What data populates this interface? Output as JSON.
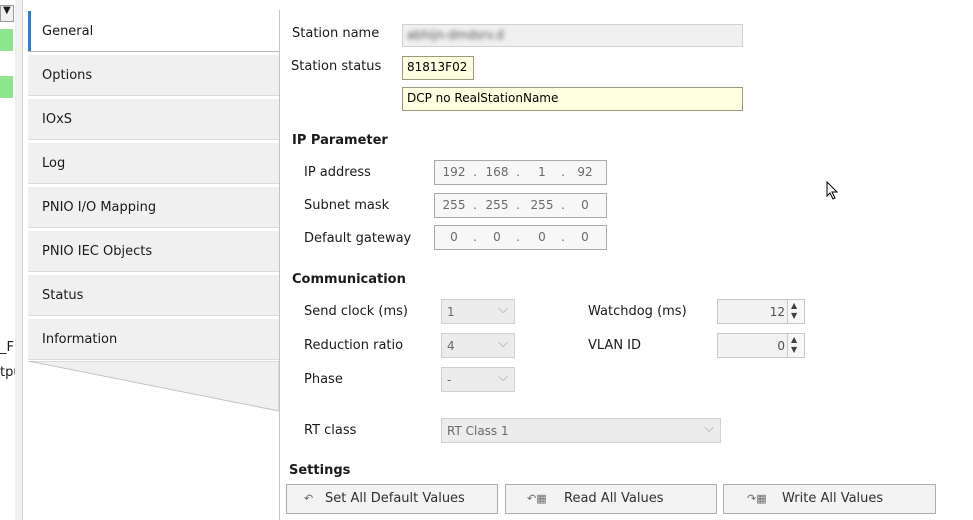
{
  "left_strip": {
    "fragments": [
      "_F",
      "tpu"
    ]
  },
  "tabs": [
    {
      "label": "General",
      "active": true
    },
    {
      "label": "Options"
    },
    {
      "label": "IOxS"
    },
    {
      "label": "Log"
    },
    {
      "label": "PNIO I/O Mapping"
    },
    {
      "label": "PNIO IEC Objects"
    },
    {
      "label": "Status"
    },
    {
      "label": "Information"
    }
  ],
  "general": {
    "station_name_label": "Station name",
    "station_name_value": "abhijn-dmdsrv.d",
    "station_status_label": "Station status",
    "station_status_code": "81813F02",
    "station_status_message": "DCP no RealStationName"
  },
  "ip_parameter": {
    "title": "IP Parameter",
    "ip_address_label": "IP address",
    "ip_address": [
      "192",
      "168",
      "1",
      "92"
    ],
    "subnet_mask_label": "Subnet mask",
    "subnet_mask": [
      "255",
      "255",
      "255",
      "0"
    ],
    "gateway_label": "Default gateway",
    "gateway": [
      "0",
      "0",
      "0",
      "0"
    ]
  },
  "communication": {
    "title": "Communication",
    "send_clock_label": "Send clock (ms)",
    "send_clock_value": "1",
    "reduction_ratio_label": "Reduction ratio",
    "reduction_ratio_value": "4",
    "phase_label": "Phase",
    "phase_value": "-",
    "watchdog_label": "Watchdog (ms)",
    "watchdog_value": "12",
    "vlan_label": "VLAN ID",
    "vlan_value": "0",
    "rt_class_label": "RT class",
    "rt_class_value": "RT Class 1"
  },
  "settings": {
    "title": "Settings",
    "set_defaults_label": "Set All Default Values",
    "read_all_label": "Read All Values",
    "write_all_label": "Write All Values"
  },
  "colors": {
    "active_tab_accent": "#2a7fd4",
    "status_yellow": "#ffffe1",
    "green_indicator": "#8fe48f"
  }
}
